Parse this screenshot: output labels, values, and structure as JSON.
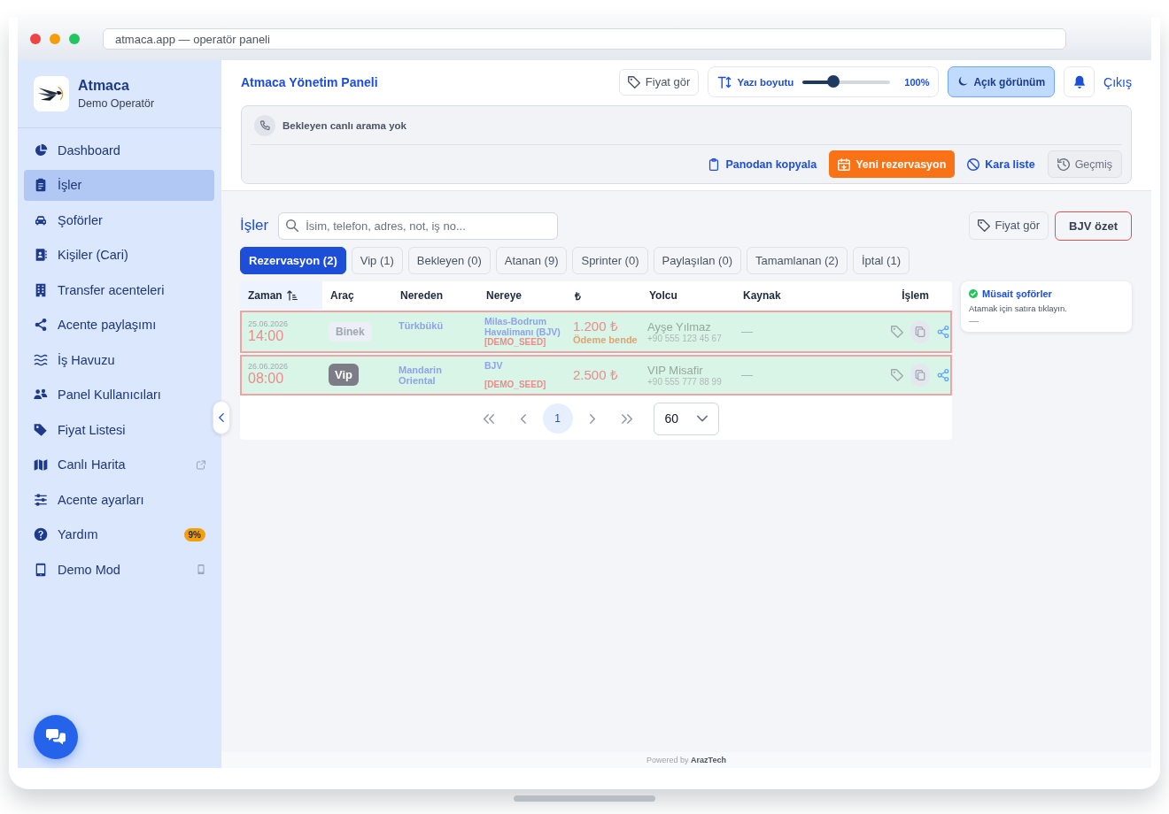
{
  "browser": {
    "address": "atmaca.app — operatör paneli"
  },
  "sidebar": {
    "brand": "Atmaca",
    "user": "Demo Operatör",
    "items": [
      {
        "label": "Dashboard",
        "selected": false,
        "kind": "plain"
      },
      {
        "label": "İşler",
        "selected": true,
        "kind": "plain"
      },
      {
        "label": "Şoförler",
        "selected": false,
        "kind": "plain"
      },
      {
        "label": "Kişiler (Cari)",
        "selected": false,
        "kind": "plain"
      },
      {
        "label": "Transfer acenteleri",
        "selected": false,
        "kind": "plain"
      },
      {
        "label": "Acente paylaşımı",
        "selected": false,
        "kind": "plain"
      },
      {
        "label": "İş Havuzu",
        "selected": false,
        "kind": "plain"
      },
      {
        "label": "Panel Kullanıcıları",
        "selected": false,
        "kind": "plain"
      },
      {
        "label": "Fiyat Listesi",
        "selected": false,
        "kind": "plain"
      },
      {
        "label": "Canlı Harita",
        "selected": false,
        "kind": "external"
      },
      {
        "label": "Acente ayarları",
        "selected": false,
        "kind": "plain"
      },
      {
        "label": "Yardım",
        "selected": false,
        "kind": "badge",
        "badge": "9%"
      },
      {
        "label": "Demo Mod",
        "selected": false,
        "kind": "device"
      }
    ]
  },
  "header": {
    "title": "Atmaca Yönetim Paneli",
    "price_button": "Fiyat gör",
    "font_size": {
      "label": "Yazı boyutu",
      "level": 0.35,
      "value": "100%"
    },
    "theme_button": "Açık görünüm",
    "logout": "Çıkış"
  },
  "calls": {
    "status": "Bekleyen canlı arama yok",
    "actions": [
      {
        "label": "Panodan kopyala",
        "kind": "link"
      },
      {
        "label": "Yeni rezervasyon",
        "kind": "primary"
      },
      {
        "label": "Kara liste",
        "kind": "link"
      },
      {
        "label": "Geçmiş",
        "kind": "secondary"
      }
    ]
  },
  "jobs": {
    "title": "İşler",
    "search": {
      "placeholder": "İsim, telefon, adres, not, iş no..."
    },
    "actions": [
      {
        "label": "Fiyat gör",
        "kind": "secondary"
      },
      {
        "label": "BJV özet",
        "kind": "summary"
      }
    ],
    "tabs": [
      {
        "label": "Rezervasyon (2)",
        "selected": true
      },
      {
        "label": "Vip (1)",
        "selected": false
      },
      {
        "label": "Bekleyen (0)",
        "selected": false
      },
      {
        "label": "Atanan (9)",
        "selected": false
      },
      {
        "label": "Sprinter (0)",
        "selected": false
      },
      {
        "label": "Paylaşılan (0)",
        "selected": false
      },
      {
        "label": "Tamamlanan (2)",
        "selected": false
      },
      {
        "label": "İptal (1)",
        "selected": false
      }
    ],
    "table": {
      "columns": [
        {
          "label": "Zaman",
          "sorted": true
        },
        {
          "label": "Araç",
          "sorted": false
        },
        {
          "label": "Nereden",
          "sorted": false
        },
        {
          "label": "Nereye",
          "sorted": false
        },
        {
          "label": "₺",
          "sorted": false
        },
        {
          "label": "Yolcu",
          "sorted": false
        },
        {
          "label": "Kaynak",
          "sorted": false
        },
        {
          "label": "İşlem",
          "sorted": false
        }
      ],
      "rows": [
        {
          "date": "25.06.2026",
          "time": "14:00",
          "vehicle": {
            "label": "Binek",
            "kind": "standard"
          },
          "from": "Türkbükü",
          "to": "Milas-Bodrum Havalimanı (BJV)",
          "tag": "[DEMO_SEED]",
          "price": "1.200 ₺",
          "payment_note": "Ödeme bende",
          "passenger": "Ayşe Yılmaz",
          "phone": "+90 555 123 45 67",
          "source": "—",
          "highlighted": true
        },
        {
          "date": "26.06.2026",
          "time": "08:00",
          "vehicle": {
            "label": "Vip",
            "kind": "vip"
          },
          "from": "Mandarin Oriental",
          "to": "BJV",
          "tag": "[DEMO_SEED]",
          "price": "2.500 ₺",
          "passenger": "VIP Misafir",
          "phone": "+90 555 777 88 99",
          "source": "—",
          "highlighted": true
        }
      ]
    },
    "pagination": {
      "pages": [
        {
          "label": "1",
          "selected": true
        }
      ],
      "page_size": "60"
    }
  },
  "available_drivers": {
    "title": "Müsait şoförler",
    "hint": "Atamak için satıra tıklayın.",
    "empty": "—"
  },
  "footer": {
    "text": "Powered by **ArazTech**"
  }
}
